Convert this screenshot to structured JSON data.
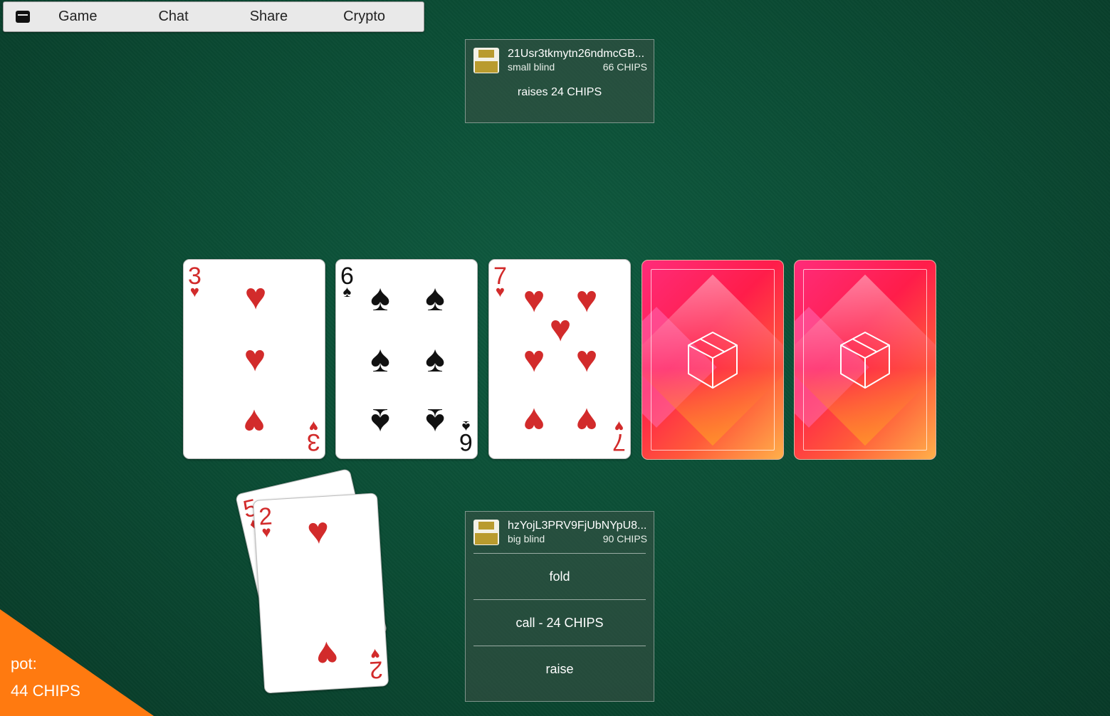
{
  "menu": {
    "items": [
      {
        "label": "Game"
      },
      {
        "label": "Chat"
      },
      {
        "label": "Share"
      },
      {
        "label": "Crypto"
      }
    ]
  },
  "opponent": {
    "name": "21Usr3tkmytn26ndmcGB...",
    "role": "small blind",
    "chips": "66 CHIPS",
    "status": "raises 24 CHIPS"
  },
  "player": {
    "name": "hzYojL3PRV9FjUbNYpU8...",
    "role": "big blind",
    "chips": "90 CHIPS",
    "actions": [
      "fold",
      "call - 24 CHIPS",
      "raise"
    ]
  },
  "board": {
    "cards": [
      {
        "rank": "3",
        "suit": "♥",
        "color": "#d22b2b"
      },
      {
        "rank": "6",
        "suit": "♠",
        "color": "#111111"
      },
      {
        "rank": "7",
        "suit": "♥",
        "color": "#d22b2b"
      },
      {
        "face": "down"
      },
      {
        "face": "down"
      }
    ]
  },
  "hand": {
    "cards": [
      {
        "rank": "5",
        "suit": "♦",
        "color": "#d22b2b"
      },
      {
        "rank": "2",
        "suit": "♥",
        "color": "#d22b2b"
      }
    ]
  },
  "pot": {
    "label": "pot:",
    "amount": "44 CHIPS"
  }
}
